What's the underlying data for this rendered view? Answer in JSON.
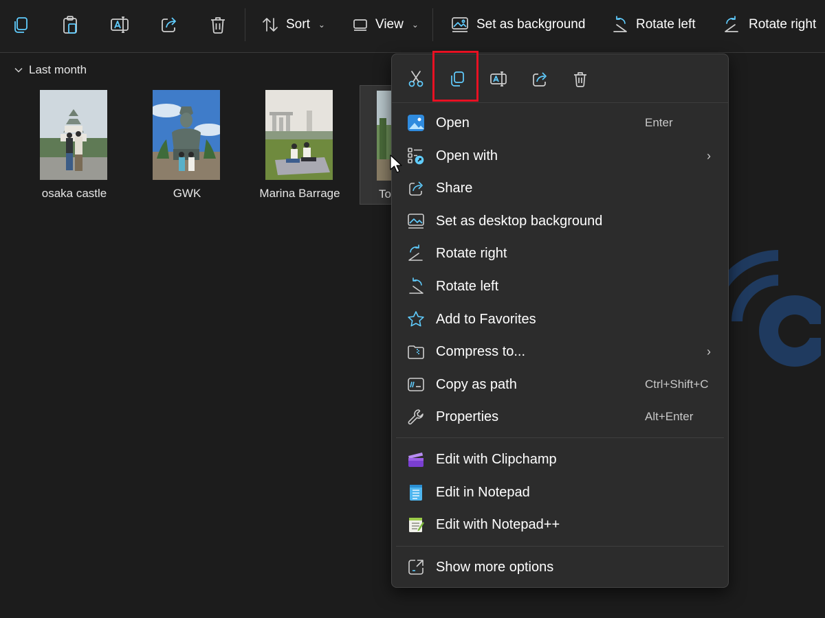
{
  "toolbar": {
    "sort_label": "Sort",
    "view_label": "View",
    "set_background_label": "Set as background",
    "rotate_left_label": "Rotate left",
    "rotate_right_label": "Rotate right",
    "icons": [
      "copy-icon",
      "paste-icon",
      "rename-icon",
      "share-icon",
      "delete-icon",
      "sort-icon",
      "view-icon",
      "background-icon",
      "rotate-left-icon",
      "rotate-right-icon"
    ]
  },
  "group": {
    "label": "Last month",
    "expanded": true
  },
  "files": [
    {
      "name": "osaka castle",
      "selected": false
    },
    {
      "name": "GWK",
      "selected": false
    },
    {
      "name": "Marina Barrage",
      "selected": false
    },
    {
      "name": "To",
      "selected": true
    }
  ],
  "context_menu": {
    "quick_actions": [
      "cut-icon",
      "copy-icon",
      "rename-icon",
      "share-icon",
      "delete-icon"
    ],
    "highlighted_action": "copy-icon",
    "items": [
      {
        "label": "Open",
        "shortcut": "Enter",
        "icon": "photos-icon"
      },
      {
        "label": "Open with",
        "submenu": true,
        "icon": "open-with-icon"
      },
      {
        "label": "Share",
        "icon": "share-icon"
      },
      {
        "label": "Set as desktop background",
        "icon": "background-icon"
      },
      {
        "label": "Rotate right",
        "icon": "rotate-right-icon"
      },
      {
        "label": "Rotate left",
        "icon": "rotate-left-icon"
      },
      {
        "label": "Add to Favorites",
        "icon": "star-icon"
      },
      {
        "label": "Compress to...",
        "submenu": true,
        "icon": "zip-icon"
      },
      {
        "label": "Copy as path",
        "shortcut": "Ctrl+Shift+C",
        "icon": "path-icon"
      },
      {
        "label": "Properties",
        "shortcut": "Alt+Enter",
        "icon": "wrench-icon"
      }
    ],
    "app_items": [
      {
        "label": "Edit with Clipchamp",
        "icon": "clipchamp-icon"
      },
      {
        "label": "Edit in Notepad",
        "icon": "notepad-icon"
      },
      {
        "label": "Edit with Notepad++",
        "icon": "notepadpp-icon"
      }
    ],
    "more_options": {
      "label": "Show more options",
      "icon": "more-options-icon"
    },
    "submenu_arrow": "›"
  },
  "colors": {
    "background": "#1c1c1c",
    "menu_background": "#2c2c2c",
    "accent": "#60cdff",
    "highlight": "#e81123",
    "watermark": "#1f3a5f"
  }
}
